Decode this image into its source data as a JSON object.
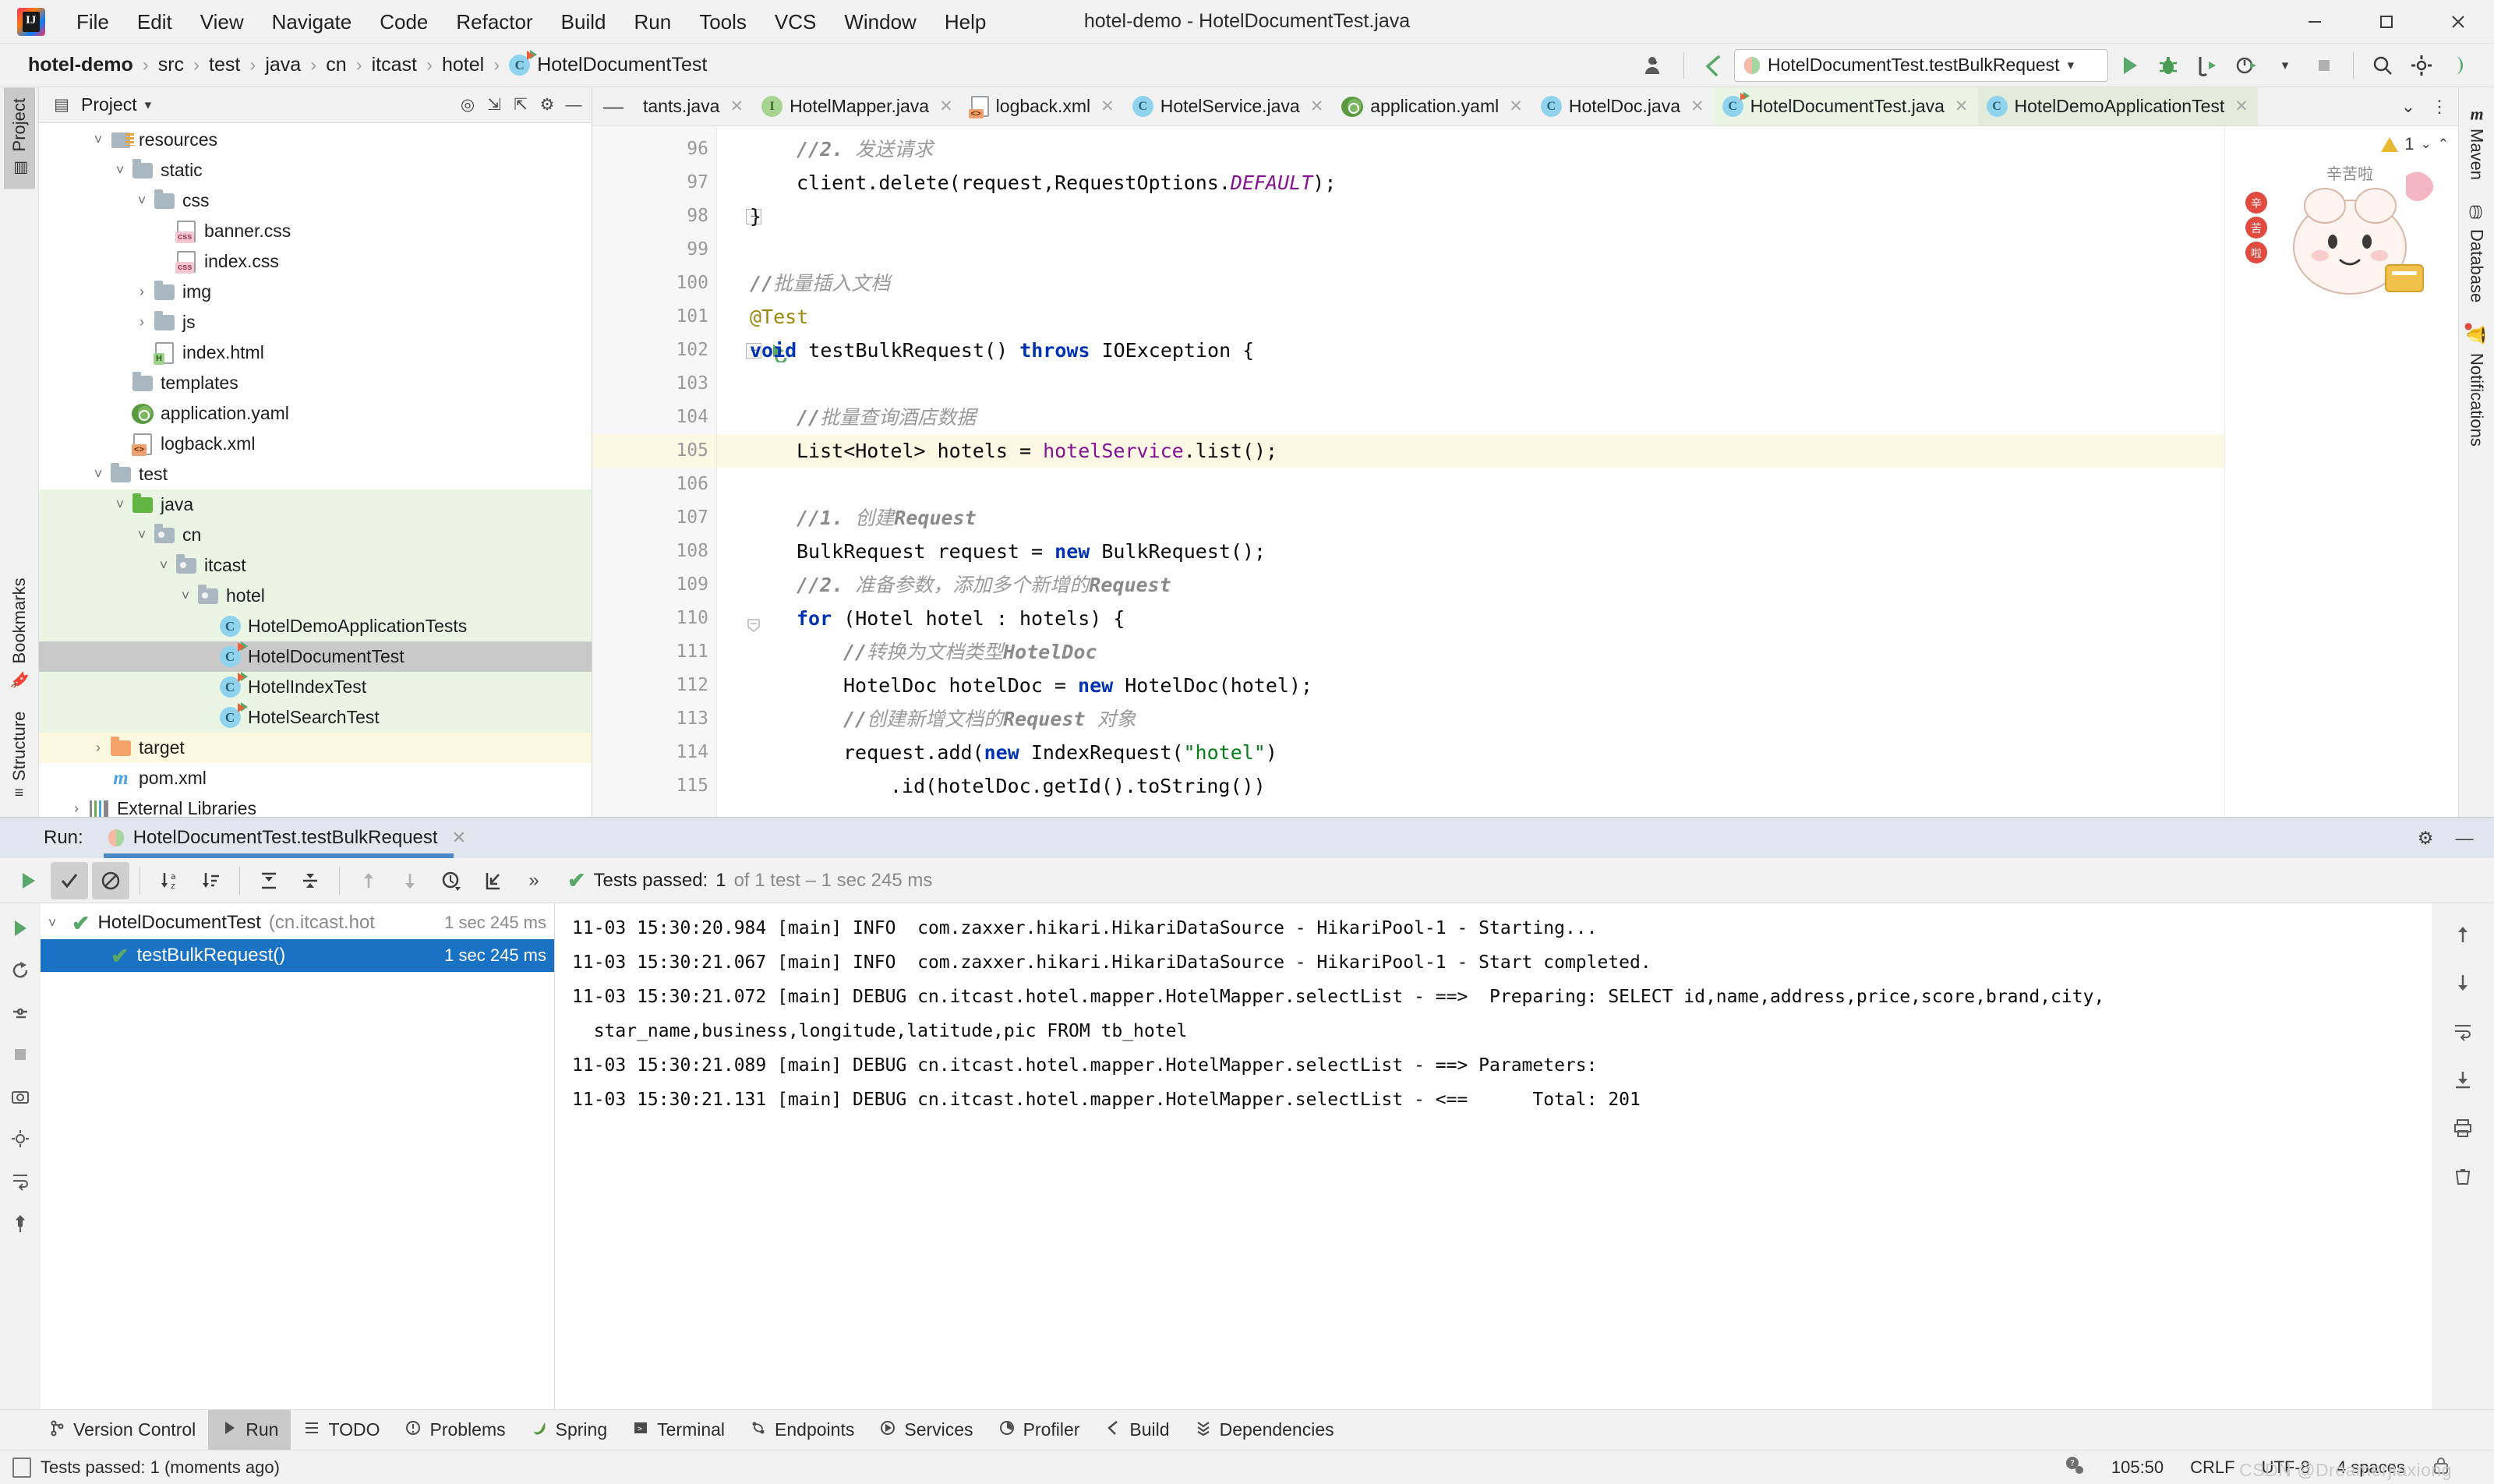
{
  "window": {
    "title": "hotel-demo - HotelDocumentTest.java",
    "minimize": "—",
    "maximize": "❐",
    "close": "✕"
  },
  "menubar": {
    "items": [
      "File",
      "Edit",
      "View",
      "Navigate",
      "Code",
      "Refactor",
      "Build",
      "Run",
      "Tools",
      "VCS",
      "Window",
      "Help"
    ]
  },
  "breadcrumb": {
    "items": [
      "hotel-demo",
      "src",
      "test",
      "java",
      "cn",
      "itcast",
      "hotel",
      "HotelDocumentTest"
    ],
    "separator": "›"
  },
  "toolbar": {
    "run_config": "HotelDocumentTest.testBulkRequest",
    "run_tooltip": "Run",
    "debug_tooltip": "Debug",
    "coverage_tooltip": "Run with Coverage",
    "profile_tooltip": "Profile",
    "stop_tooltip": "Stop",
    "search_tooltip": "Search Everywhere",
    "settings_tooltip": "Settings",
    "updates_tooltip": "IDE and Project Settings"
  },
  "project_panel": {
    "title": "Project",
    "tree": [
      {
        "label": "resources",
        "depth": 2,
        "arrow": "˅",
        "icon": "resources-folder",
        "bg": "none",
        "cut_top": true
      },
      {
        "label": "static",
        "depth": 3,
        "arrow": "˅",
        "icon": "folder",
        "bg": "none"
      },
      {
        "label": "css",
        "depth": 4,
        "arrow": "˅",
        "icon": "folder",
        "bg": "none"
      },
      {
        "label": "banner.css",
        "depth": 5,
        "arrow": "",
        "icon": "css-file",
        "bg": "none"
      },
      {
        "label": "index.css",
        "depth": 5,
        "arrow": "",
        "icon": "css-file",
        "bg": "none"
      },
      {
        "label": "img",
        "depth": 4,
        "arrow": "›",
        "icon": "folder",
        "bg": "none"
      },
      {
        "label": "js",
        "depth": 4,
        "arrow": "›",
        "icon": "folder",
        "bg": "none"
      },
      {
        "label": "index.html",
        "depth": 4,
        "arrow": "",
        "icon": "html-file",
        "bg": "none"
      },
      {
        "label": "templates",
        "depth": 3,
        "arrow": "",
        "icon": "folder",
        "bg": "none"
      },
      {
        "label": "application.yaml",
        "depth": 3,
        "arrow": "",
        "icon": "spring-file",
        "bg": "none"
      },
      {
        "label": "logback.xml",
        "depth": 3,
        "arrow": "",
        "icon": "xml-file",
        "bg": "none"
      },
      {
        "label": "test",
        "depth": 2,
        "arrow": "˅",
        "icon": "folder",
        "bg": "none"
      },
      {
        "label": "java",
        "depth": 3,
        "arrow": "˅",
        "icon": "folder-green",
        "bg": "green"
      },
      {
        "label": "cn",
        "depth": 4,
        "arrow": "˅",
        "icon": "package",
        "bg": "green"
      },
      {
        "label": "itcast",
        "depth": 5,
        "arrow": "˅",
        "icon": "package",
        "bg": "green"
      },
      {
        "label": "hotel",
        "depth": 6,
        "arrow": "˅",
        "icon": "package",
        "bg": "green"
      },
      {
        "label": "HotelDemoApplicationTests",
        "depth": 7,
        "arrow": "",
        "icon": "class",
        "bg": "green"
      },
      {
        "label": "HotelDocumentTest",
        "depth": 7,
        "arrow": "",
        "icon": "class-run",
        "bg": "selected"
      },
      {
        "label": "HotelIndexTest",
        "depth": 7,
        "arrow": "",
        "icon": "class-run",
        "bg": "green"
      },
      {
        "label": "HotelSearchTest",
        "depth": 7,
        "arrow": "",
        "icon": "class-run",
        "bg": "green"
      },
      {
        "label": "target",
        "depth": 2,
        "arrow": "›",
        "icon": "folder-orange",
        "bg": "yellow"
      },
      {
        "label": "pom.xml",
        "depth": 2,
        "arrow": "",
        "icon": "maven-file",
        "bg": "none"
      },
      {
        "label": "External Libraries",
        "depth": 1,
        "arrow": "›",
        "icon": "library",
        "bg": "none"
      }
    ]
  },
  "left_tool_strip": {
    "top": [
      {
        "label": "Project",
        "icon": "project-icon",
        "active": true
      }
    ],
    "bottom": [
      {
        "label": "Bookmarks",
        "icon": "bookmark-icon",
        "active": false
      },
      {
        "label": "Structure",
        "icon": "structure-icon",
        "active": false
      }
    ]
  },
  "right_tool_strip": {
    "items": [
      {
        "label": "Maven",
        "icon": "maven-icon"
      },
      {
        "label": "Database",
        "icon": "database-icon"
      },
      {
        "label": "Notifications",
        "icon": "bell-icon",
        "badge": true
      }
    ]
  },
  "editor_tabs": [
    {
      "label": "tants.java",
      "icon": "class",
      "state": "truncated"
    },
    {
      "label": "HotelMapper.java",
      "icon": "interface",
      "state": "normal"
    },
    {
      "label": "logback.xml",
      "icon": "xml-file",
      "state": "normal"
    },
    {
      "label": "HotelService.java",
      "icon": "class",
      "state": "normal"
    },
    {
      "label": "application.yaml",
      "icon": "spring-file",
      "state": "normal"
    },
    {
      "label": "HotelDoc.java",
      "icon": "class",
      "state": "normal"
    },
    {
      "label": "HotelDocumentTest.java",
      "icon": "class-run",
      "state": "active"
    },
    {
      "label": "HotelDemoApplicationTest",
      "icon": "class",
      "state": "active2"
    }
  ],
  "editor": {
    "warning_count": "1",
    "caret_position": "105:50",
    "lines": [
      {
        "num": "96",
        "indent": 4,
        "html": "<span class='cmb'>//2.</span> <span class='cm'>发送请求</span>",
        "hl": false
      },
      {
        "num": "97",
        "indent": 4,
        "html": "client.delete(request,RequestOptions.<span class='stat'>DEFAULT</span>);",
        "hl": false
      },
      {
        "num": "98",
        "indent": 0,
        "html": "}",
        "hl": false,
        "fold": "end"
      },
      {
        "num": "99",
        "indent": 0,
        "html": "",
        "hl": false
      },
      {
        "num": "100",
        "indent": 0,
        "html": "<span class='cmb'>//</span><span class='cm'>批量插入文档</span>",
        "hl": false
      },
      {
        "num": "101",
        "indent": 0,
        "html": "<span class='ann'>@Test</span>",
        "hl": false
      },
      {
        "num": "102",
        "indent": 0,
        "html": "<span class='kw'>void</span> testBulkRequest() <span class='kw'>throws</span> IOException {",
        "hl": false,
        "fold": "start",
        "runmark": true
      },
      {
        "num": "103",
        "indent": 0,
        "html": "",
        "hl": false
      },
      {
        "num": "104",
        "indent": 4,
        "html": "<span class='cmb'>//</span><span class='cm'>批量查询酒店数据</span>",
        "hl": false
      },
      {
        "num": "105",
        "indent": 4,
        "html": "List&lt;Hotel&gt; hotels = <span class='fld'>hotelService</span>.list();",
        "hl": true
      },
      {
        "num": "106",
        "indent": 0,
        "html": "",
        "hl": false
      },
      {
        "num": "107",
        "indent": 4,
        "html": "<span class='cmb'>//1.</span> <span class='cm'>创建</span><span class='cmb'>Request</span>",
        "hl": false
      },
      {
        "num": "108",
        "indent": 4,
        "html": "BulkRequest request = <span class='kw'>new</span> BulkRequest();",
        "hl": false
      },
      {
        "num": "109",
        "indent": 4,
        "html": "<span class='cmb'>//2.</span> <span class='cm'>准备参数，添加多个新增的</span><span class='cmb'>Request</span>",
        "hl": false
      },
      {
        "num": "110",
        "indent": 4,
        "html": "<span class='kw'>for</span> (Hotel hotel : hotels) {",
        "hl": false,
        "fold": "startpt"
      },
      {
        "num": "111",
        "indent": 8,
        "html": "<span class='cmb'>//</span><span class='cm'>转换为文档类型</span><span class='cmb'>HotelDoc</span>",
        "hl": false
      },
      {
        "num": "112",
        "indent": 8,
        "html": "HotelDoc hotelDoc = <span class='kw'>new</span> HotelDoc(hotel);",
        "hl": false
      },
      {
        "num": "113",
        "indent": 8,
        "html": "<span class='cmb'>//</span><span class='cm'>创建新增文档的</span><span class='cmb'>Request</span> <span class='cm'>对象</span>",
        "hl": false
      },
      {
        "num": "114",
        "indent": 8,
        "html": "request.add(<span class='kw'>new</span> IndexRequest(<span class='str'>\"hotel\"</span>)",
        "hl": false
      },
      {
        "num": "115",
        "indent": 12,
        "html": ".id(hotelDoc.getId().toString())",
        "hl": false
      }
    ]
  },
  "run_panel": {
    "label": "Run:",
    "tab_title": "HotelDocumentTest.testBulkRequest",
    "tab_close": "✕",
    "status_prefix": "Tests passed:",
    "status_count": "1",
    "status_suffix": "of 1 test – 1 sec 245 ms",
    "toolbar": {
      "rerun": "rerun-icon",
      "show_passed": "show-passed-icon",
      "show_ignored": "show-ignored-icon",
      "sort_alpha": "sort-alphabetically-icon",
      "sort_duration": "sort-by-duration-icon",
      "expand_all": "expand-all-icon",
      "collapse_all": "collapse-all-icon",
      "prev_failed": "previous-failed-icon",
      "next_failed": "next-failed-icon",
      "history": "test-history-icon",
      "export": "export-icon",
      "more": "»"
    },
    "tree": [
      {
        "label": "HotelDocumentTest",
        "suffix": "(cn.itcast.hot",
        "time": "1 sec 245 ms",
        "selected": false,
        "arrow": "˅"
      },
      {
        "label": "testBulkRequest()",
        "suffix": "",
        "time": "1 sec 245 ms",
        "selected": true,
        "arrow": ""
      }
    ],
    "console": [
      "11-03 15:30:20.984 [main] INFO  com.zaxxer.hikari.HikariDataSource - HikariPool-1 - Starting...",
      "11-03 15:30:21.067 [main] INFO  com.zaxxer.hikari.HikariDataSource - HikariPool-1 - Start completed.",
      "11-03 15:30:21.072 [main] DEBUG cn.itcast.hotel.mapper.HotelMapper.selectList - ==>  Preparing: SELECT id,name,address,price,score,brand,city,",
      "  star_name,business,longitude,latitude,pic FROM tb_hotel",
      "11-03 15:30:21.089 [main] DEBUG cn.itcast.hotel.mapper.HotelMapper.selectList - ==> Parameters:",
      "11-03 15:30:21.131 [main] DEBUG cn.itcast.hotel.mapper.HotelMapper.selectList - <==      Total: 201"
    ]
  },
  "tool_window_bar": [
    {
      "label": "Version Control",
      "icon": "vcs-icon",
      "active": false
    },
    {
      "label": "Run",
      "icon": "run-icon",
      "active": true
    },
    {
      "label": "TODO",
      "icon": "todo-icon",
      "active": false
    },
    {
      "label": "Problems",
      "icon": "problems-icon",
      "active": false
    },
    {
      "label": "Spring",
      "icon": "spring-icon",
      "active": false
    },
    {
      "label": "Terminal",
      "icon": "terminal-icon",
      "active": false
    },
    {
      "label": "Endpoints",
      "icon": "endpoints-icon",
      "active": false
    },
    {
      "label": "Services",
      "icon": "services-icon",
      "active": false
    },
    {
      "label": "Profiler",
      "icon": "profiler-icon",
      "active": false
    },
    {
      "label": "Build",
      "icon": "build-icon",
      "active": false
    },
    {
      "label": "Dependencies",
      "icon": "dependencies-icon",
      "active": false
    }
  ],
  "status_bar": {
    "message": "Tests passed: 1 (moments ago)",
    "caret": "105:50",
    "line_separator": "CRLF",
    "encoding": "UTF-8",
    "indent": "4 spaces",
    "watermark": "CSDN @Dreamerjiaxiong"
  },
  "colors": {
    "accent_blue": "#1a72c4",
    "green_pass": "#59a869",
    "keyword_blue": "#0033b3",
    "string_green": "#067d17",
    "field_purple": "#871094",
    "annotation_yellow": "#9e880d",
    "highlight_line": "#fdf8e3",
    "tab_active_green": "#eaf5e4"
  }
}
